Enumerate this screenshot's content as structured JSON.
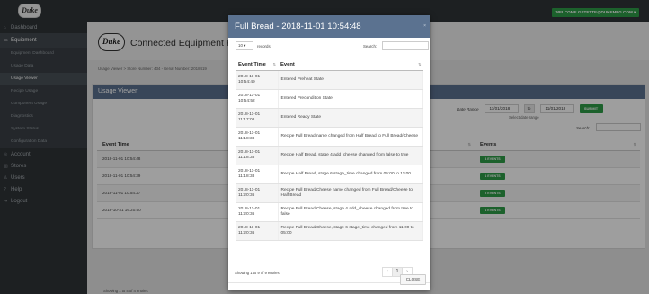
{
  "topbar": {
    "logo_text": "Duke",
    "welcome": "WELCOME GSTETTE@DUKEMFG.COM ▾"
  },
  "sidebar": {
    "items": [
      {
        "icon": "⌂",
        "label": "Dashboard"
      },
      {
        "icon": "▭",
        "label": "Equipment"
      }
    ],
    "sub_items": [
      "Equipment Dashboard",
      "Usage Data",
      "Usage Viewer",
      "Recipe Usage",
      "Component Usage",
      "Diagnostics",
      "System Status",
      "Configuration Data"
    ],
    "lower_items": [
      {
        "icon": "◎",
        "label": "Account"
      },
      {
        "icon": "▥",
        "label": "Stores"
      },
      {
        "icon": "♙",
        "label": "Users"
      },
      {
        "icon": "?",
        "label": "Help"
      },
      {
        "icon": "⇥",
        "label": "Logout"
      }
    ]
  },
  "main": {
    "logo_text": "Duke",
    "app_title": "Connected Equipment Pla",
    "breadcrumb_prefix": "Usage Viewer  >  Store Number: 434 - Serial Number: 2018419",
    "panel_title": "Usage Viewer",
    "date_range_label": "Date Range",
    "date_from": "11/01/2018",
    "to_label": "to",
    "date_to": "11/01/2018",
    "submit": "SUBMIT",
    "hint": "Select date range",
    "search_label": "Search:",
    "table": {
      "col_time": "Event Time",
      "col_events": "Events",
      "rows": [
        {
          "time": "2018-11-01 10:54:48",
          "events": "4 EVENTS"
        },
        {
          "time": "2018-11-01 10:54:39",
          "events": "1 EVENTS"
        },
        {
          "time": "2018-11-01 10:54:27",
          "events": "2 EVENTS"
        },
        {
          "time": "2018-10-31 16:20:50",
          "events": "1 EVENTS"
        }
      ]
    },
    "showing": "Showing 1 to 4 of 4 entries"
  },
  "modal": {
    "title": "Full Bread - 2018-11-01 10:54:48",
    "x_label": "×",
    "length_value": "10",
    "length_label": "records",
    "search_label": "Search:",
    "col_time": "Event Time",
    "col_event": "Event",
    "rows": [
      {
        "time": "2018-11-01 10:54:49",
        "event": "Entered Preheat State"
      },
      {
        "time": "2018-11-01 10:54:52",
        "event": "Entered Precondition State"
      },
      {
        "time": "2018-11-01 11:17:08",
        "event": "Entered Ready State"
      },
      {
        "time": "2018-11-01 11:18:38",
        "event": "Recipe Full Bread name changed from Half Bread to Full Bread/Cheese"
      },
      {
        "time": "2018-11-01 11:18:38",
        "event": "Recipe Half Bread, stage 4 add_cheese changed from false to true"
      },
      {
        "time": "2018-11-01 11:18:38",
        "event": "Recipe Half Bread, stage 6 stage_time changed from 05:00 to 11:00"
      },
      {
        "time": "2018-11-01 11:20:36",
        "event": "Recipe Full Bread/Cheese name changed from Full Bread/Cheese to Half Bread"
      },
      {
        "time": "2018-11-01 11:20:36",
        "event": "Recipe Full Bread/Cheese, stage 4 add_cheese changed from true to false"
      },
      {
        "time": "2018-11-01 11:20:36",
        "event": "Recipe Full Bread/Cheese, stage 6 stage_time changed from 11:00 to 05:00"
      }
    ],
    "showing": "Showing 1 to 9 of 9 entries",
    "pager_prev": "‹",
    "pager_page": "1",
    "pager_next": "›",
    "close": "CLOSE"
  },
  "colors": {
    "header_blue": "#5b7290",
    "accent_green": "#2e9d48",
    "sidebar_dark": "#2f3438"
  }
}
